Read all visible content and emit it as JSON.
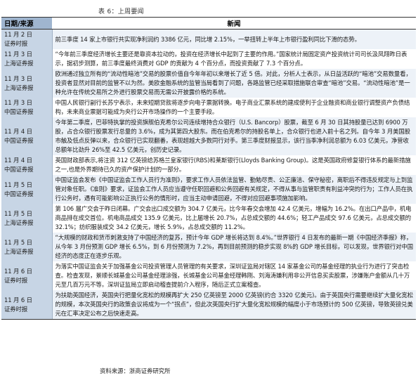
{
  "caption": "表 6：上周要闻",
  "header": {
    "col1": "日期/来源",
    "col2": "新闻"
  },
  "rows": [
    {
      "date": "11 月 2 日\n证券时报",
      "text": "前三季度 14 家上市银行共实现净利润约 3386 亿元，同比增 2.15%，一举扭转上半年上市银行盈利同比下滑的态势。",
      "height": 35
    },
    {
      "date": "11 月 3 日\n上海证券报",
      "text": "“今年前三季度经济增长主要还是靠资本拉动的，投资在经济增长中起到了主要的作用。”国家统计局固定资产投资统计司司长汲凤翔昨日表示，据初步测算，前三季度最终消费对 GDP 的贡献为 4 个百分点，而投资贡献了 7.3 个百分点。",
      "height": 41
    },
    {
      "date": "11 月 3 日\n上海证券报",
      "text": "欧洲通过独立所有的“流动性暗池”交易的股票价值自今年年初以来增长了近 5 倍。对此，分析人士表示，从日益活跃的“暗池”交易数量看，投资者显然对目前的监管不以为然。美欧金融系统的监管当局看到了问题，各路监管已经采取措施联合审查“暗池”交易。“流动性暗池”是一种允许在传统交易所之外进行股票交易而无需公开披露价格的系统。",
      "height": 55
    },
    {
      "date": "11 月 3 日\n中国证券报",
      "text": "中国人民银行副行长苏宁表示，未来短期贷款将逐步向电子票据转换。电子商业汇票系统的建成使利于企业融资和商业银行调整资产负债结构，未来商业票据可能成为央行公开市场操作的一个主要手段。",
      "height": 38
    },
    {
      "date": "11 月 4 日\n中国证券报",
      "text": "今年第二季度，巴菲特执掌的投资旗舰伯克希尔公司连续增持合众银行（U.S. Bancorp）股票，截至 6 月 30 日其持股量已达到 6900 万股，占合众银行股票发行总量的 3.6%，成为其第四大股东。而在伯克希尔的持股名单上，合众银行也进入前十名之列。自今年 3 月美国股市触及低点反弹以来，合众银行已实现翻番，表现超越大多数同行对手。第三季度财报显示，该行当季净利润总额为 6.03 亿美元，净营收总额年比劲升 26%至 42.5 亿美元，创历史记录。",
      "height": 70
    },
    {
      "date": "11 月 4 日\n中国证券报",
      "text": "英国财政部表示,将注资 312 亿英镑给苏格兰皇家银行(RBS)和莱斯银行(Lloyds Banking Group)。这是英国政府修复银行体系的最新措施之一,也是外界期待已久的资产保护计划的一部分。",
      "height": 35
    },
    {
      "date": "11 月 5 日\n中国证券报",
      "text": "中国证监会发布《中国证监会工作人员行为准则》，要求工作人员依法监管、勤勉尽责、公正廉洁、保守秘密，离职后不得违反规定与上到监管对象任职。《准则》要求，证监会工作人员应当遵守任职回避和公务回避有关规定，不得从事与监管职责有利益冲突的行为；工作人员在执行公务时，遇有可能影响公正执行公务的情形时，应当主动申请回避，不得对应回避事项施加影响。",
      "height": 55
    },
    {
      "date": "11 月 5 日\n上海证券报",
      "text": "第 106 届广交会于昨日闭幕。广交会出口成交额为 304.7 亿美元，比今年春交会增加 42.4 亿美元，增幅为 16.2%。在出口产品中，机电商品排在成交首位。机电商品成交 135.9 亿美元，比上届增长 20.7%，占总成交额的 44.6%；轻工产品成交 97.6 亿美元，占总成交额的 32.1%；纺织服装成交 34.2 亿美元，增长 5.9%，占总成交额的 11.2%。",
      "height": 55
    },
    {
      "date": "11 月 5 日\n上海证券报",
      "text": "“大规模的财政和货币刺激支持了中国经济的复苏，预计今年 GDP 增长将达到 8.4%。”世界银行 4 日发布的最新一期《中国经济季报》称，从今年 3 月份预测 GDP 增长 6.5%，到 6 月份预测为 7.2%，再到目前预测的稳步实现 8%的 GDP 增长目标，可以发现，世界银行对中国经济的态度正在逐步乐观。",
      "height": 55
    },
    {
      "date": "11 月 6 日\n证券时报",
      "text": "为落实中国证监会关于加强基金公司投资管理人员管理的有关要求，深圳证监局对辖区 14 家基金公司的基金经理的执业行为进行了突击检查。检查发现，景顺长城基金公司基金经理涂强，长城基金公司基金经理韩刚、刘海涛嫌利用非公开信息买卖股票，涉嫌账户金额从几十万元至几百万元不等。深圳证监局立即启动稽查提前介入程序，随后正式立案稽查。",
      "height": 55
    },
    {
      "date": "11 月 6 日\n证券时报",
      "text": "为扶助英国经济，英国央行把量化宽松的规模再扩大 250 亿英镑至 2000 亿英镑(约合 3320 亿美元)。由于英国央行需要继续扩大量化宽松的规模，本次英国央行的政策会议将成为一个“拐点”，但此次英国央行扩大量化宽松规模的幅度小于市场预计的 500 亿英镑，导致英镑兑美元在汇率决定公布之后快速走高。",
      "height": 55
    }
  ],
  "source": "资料来源：浙商证券研究所"
}
